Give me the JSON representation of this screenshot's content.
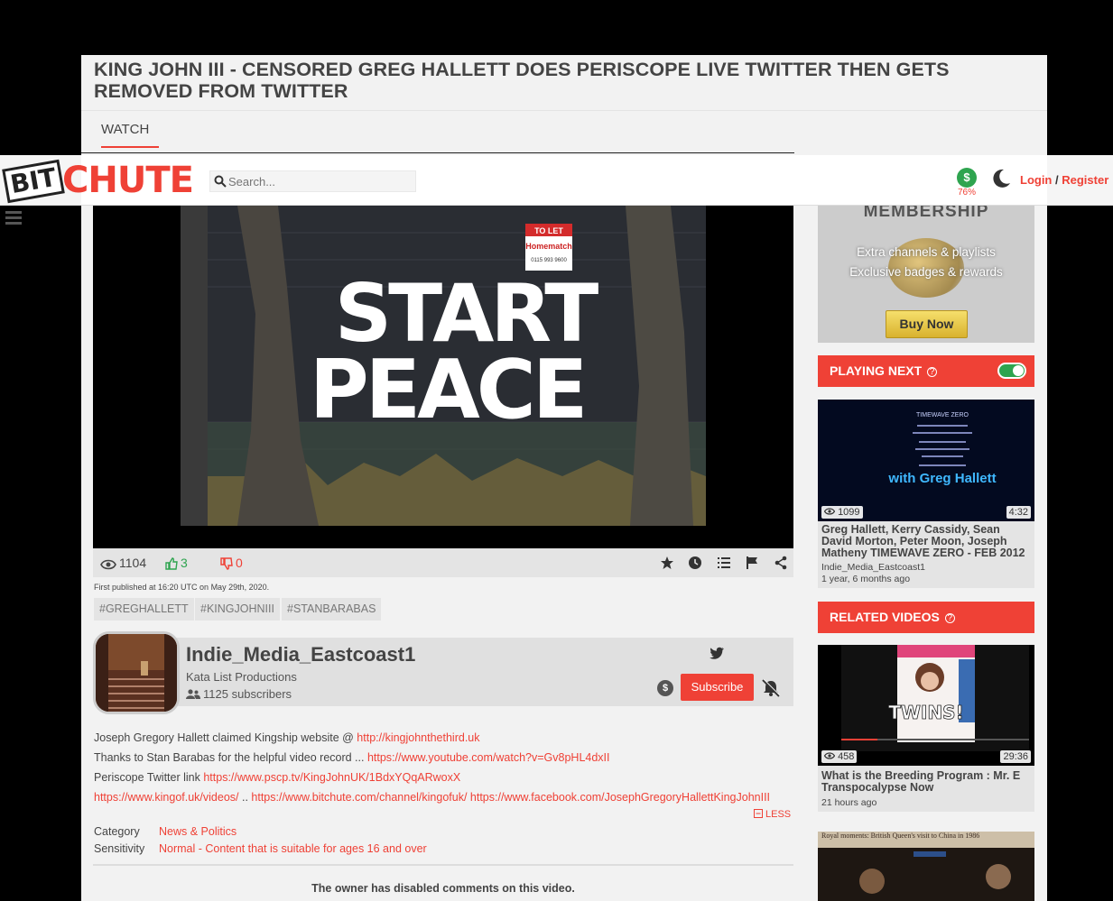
{
  "page": {
    "title": "KING JOHN III - CENSORED GREG HALLETT DOES PERISCOPE LIVE TWITTER THEN GETS REMOVED FROM TWITTER",
    "tab_watch": "WATCH"
  },
  "header": {
    "logo_bit": "BIT",
    "logo_chute": "CHUTE",
    "search_placeholder": "Search...",
    "wallet_symbol": "$",
    "wallet_percent": "76%",
    "login": "Login",
    "separator": " / ",
    "register": "Register"
  },
  "video": {
    "sign_to_let": "TO LET",
    "sign_brand": "Homematch",
    "sign_phone": "0115 993 9600",
    "mural_line1": "START",
    "mural_line2": "PEACE"
  },
  "stats": {
    "views": "1104",
    "likes": "3",
    "dislikes": "0"
  },
  "published": "First published at 16:20 UTC on May 29th, 2020.",
  "tags": [
    "#GREGHALLETT",
    "#KINGJOHNIII",
    "#STANBARABAS"
  ],
  "channel": {
    "name": "Indie_Media_Eastcoast1",
    "owner": "Kata List Productions",
    "subscribers": "1125 subscribers",
    "tip_symbol": "$",
    "subscribe_label": "Subscribe"
  },
  "description": {
    "line1_text": "Joseph Gregory Hallett claimed Kingship website @ ",
    "line1_link": "http://kingjohnthethird.uk",
    "line2_text": "Thanks to Stan Barabas for the helpful video record ... ",
    "line2_link": "https://www.youtube.com/watch?v=Gv8pHL4dxII",
    "line3_text": "Periscope Twitter link ",
    "line3_link": "https://www.pscp.tv/KingJohnUK/1BdxYQqARwoxX",
    "line4_link1": "https://www.kingof.uk/videos/",
    "line4_sep": " .. ",
    "line4_link2": "https://www.bitchute.com/channel/kingofuk/",
    "line4_space": " ",
    "line4_link3": "https://www.facebook.com/JosephGregoryHallettKingJohnIII",
    "less_label": "LESS"
  },
  "meta": {
    "category_label": "Category",
    "category_value": "News & Politics",
    "sensitivity_label": "Sensitivity",
    "sensitivity_value": "Normal - Content that is suitable for ages 16 and over"
  },
  "comments_disabled": "The owner has disabled comments on this video.",
  "sidebar": {
    "membership_title": "MEMBERSHIP",
    "membership_line1": "Extra channels & playlists",
    "membership_line2": "Exclusive badges & rewards",
    "buy_now": "Buy Now",
    "playing_next": "PLAYING NEXT",
    "related_videos": "RELATED VIDEOS",
    "help_glyph": "?",
    "next_video": {
      "thumb_text_top": "TIMEWAVE ZERO",
      "thumb_text": "with Greg Hallett",
      "views": "1099",
      "duration": "4:32",
      "title": "Greg Hallett, Kerry Cassidy, Sean David Morton, Peter Moon, Joseph Matheny TIMEWAVE ZERO - FEB 2012",
      "channel": "Indie_Media_Eastcoast1",
      "age": "1 year, 6 months ago"
    },
    "related1": {
      "thumb_text": "TWINS!",
      "views": "458",
      "duration": "29:36",
      "title": "What is the Breeding Program : Mr. E Transpocalypse Now",
      "age": "21 hours ago"
    },
    "related2": {
      "thumb_text": "Royal moments: British Queen's visit to China in 1986"
    }
  },
  "colors": {
    "accent": "#ef4136",
    "green": "#2ea44f",
    "panel": "#f2f2f2"
  }
}
